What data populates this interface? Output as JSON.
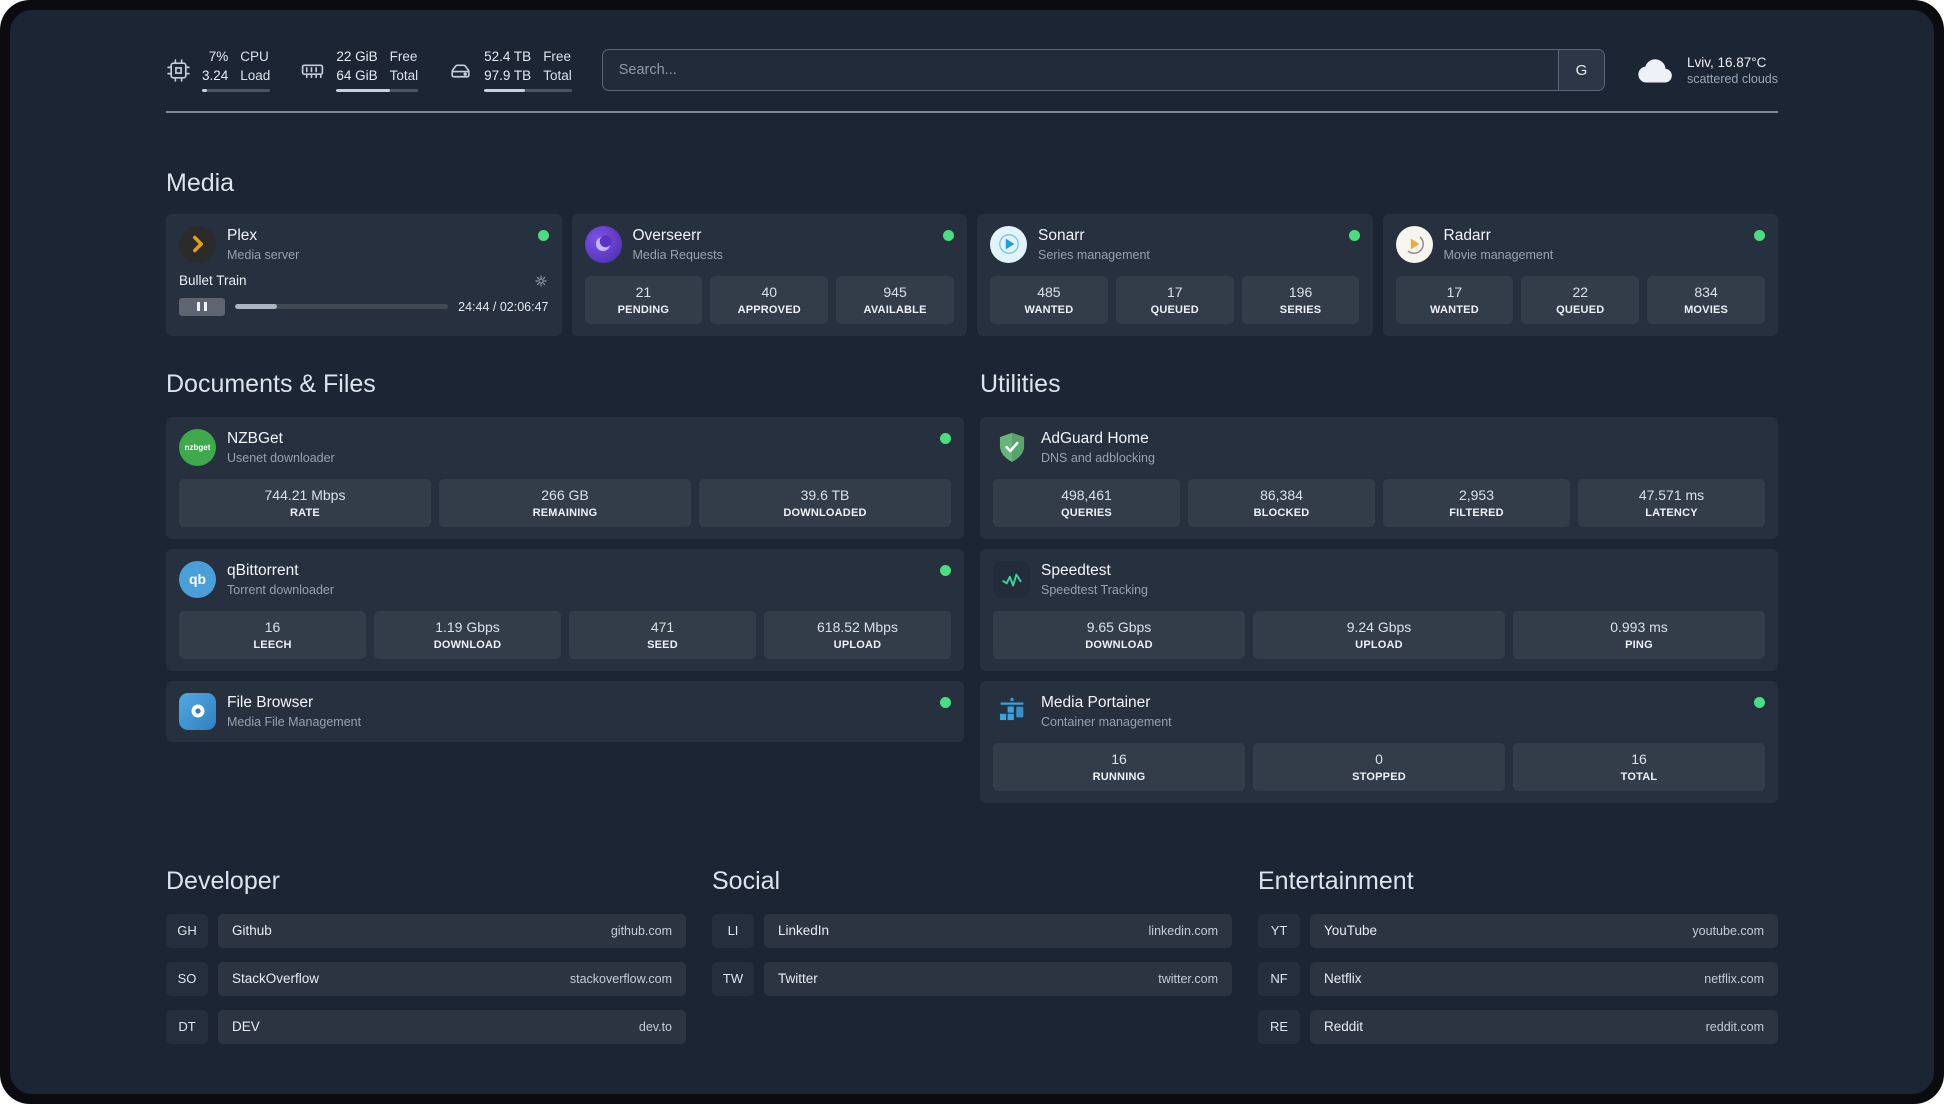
{
  "colors": {
    "background": "#1c2534",
    "status_green": "#4ade80",
    "plex_amber": "#e5a00d",
    "sonarr_blue": "#1f9fd4",
    "radarr_amber": "#f0a83c",
    "nzbget_green": "#3faa4b",
    "qbittorrent_blue": "#4a9fd8",
    "adguard_green": "#68b47a",
    "speedtest_green": "#37d399",
    "portainer_blue": "#3aa2e0"
  },
  "topbar": {
    "cpu": {
      "value_top": "7%",
      "value_bottom": "3.24",
      "label_top": "CPU",
      "label_bottom": "Load",
      "bar_percent": 7
    },
    "memory": {
      "value_top": "22 GiB",
      "value_bottom": "64 GiB",
      "label_top": "Free",
      "label_bottom": "Total",
      "bar_percent": 66
    },
    "disk": {
      "value_top": "52.4 TB",
      "value_bottom": "97.9 TB",
      "label_top": "Free",
      "label_bottom": "Total",
      "bar_percent": 47
    },
    "search": {
      "placeholder": "Search...",
      "provider_label": "G"
    },
    "weather": {
      "location_temp": "Lviv, 16.87°C",
      "condition": "scattered clouds"
    }
  },
  "media": {
    "title": "Media",
    "plex": {
      "name": "Plex",
      "subtitle": "Media server",
      "now_playing": "Bullet Train",
      "time": "24:44 / 02:06:47",
      "progress_percent": 19.5
    },
    "overseerr": {
      "name": "Overseerr",
      "subtitle": "Media Requests",
      "stats": [
        {
          "value": "21",
          "label": "PENDING"
        },
        {
          "value": "40",
          "label": "APPROVED"
        },
        {
          "value": "945",
          "label": "AVAILABLE"
        }
      ]
    },
    "sonarr": {
      "name": "Sonarr",
      "subtitle": "Series management",
      "stats": [
        {
          "value": "485",
          "label": "WANTED"
        },
        {
          "value": "17",
          "label": "QUEUED"
        },
        {
          "value": "196",
          "label": "SERIES"
        }
      ]
    },
    "radarr": {
      "name": "Radarr",
      "subtitle": "Movie management",
      "stats": [
        {
          "value": "17",
          "label": "WANTED"
        },
        {
          "value": "22",
          "label": "QUEUED"
        },
        {
          "value": "834",
          "label": "MOVIES"
        }
      ]
    }
  },
  "documents": {
    "title": "Documents & Files",
    "nzbget": {
      "name": "NZBGet",
      "subtitle": "Usenet downloader",
      "stats": [
        {
          "value": "744.21 Mbps",
          "label": "RATE"
        },
        {
          "value": "266 GB",
          "label": "REMAINING"
        },
        {
          "value": "39.6 TB",
          "label": "DOWNLOADED"
        }
      ]
    },
    "qbittorrent": {
      "name": "qBittorrent",
      "subtitle": "Torrent downloader",
      "stats": [
        {
          "value": "16",
          "label": "LEECH"
        },
        {
          "value": "1.19 Gbps",
          "label": "DOWNLOAD"
        },
        {
          "value": "471",
          "label": "SEED"
        },
        {
          "value": "618.52 Mbps",
          "label": "UPLOAD"
        }
      ]
    },
    "filebrowser": {
      "name": "File Browser",
      "subtitle": "Media File Management"
    }
  },
  "utilities": {
    "title": "Utilities",
    "adguard": {
      "name": "AdGuard Home",
      "subtitle": "DNS and adblocking",
      "stats": [
        {
          "value": "498,461",
          "label": "QUERIES"
        },
        {
          "value": "86,384",
          "label": "BLOCKED"
        },
        {
          "value": "2,953",
          "label": "FILTERED"
        },
        {
          "value": "47.571 ms",
          "label": "LATENCY"
        }
      ]
    },
    "speedtest": {
      "name": "Speedtest",
      "subtitle": "Speedtest Tracking",
      "stats": [
        {
          "value": "9.65 Gbps",
          "label": "DOWNLOAD"
        },
        {
          "value": "9.24 Gbps",
          "label": "UPLOAD"
        },
        {
          "value": "0.993 ms",
          "label": "PING"
        }
      ]
    },
    "portainer": {
      "name": "Media Portainer",
      "subtitle": "Container management",
      "stats": [
        {
          "value": "16",
          "label": "RUNNING"
        },
        {
          "value": "0",
          "label": "STOPPED"
        },
        {
          "value": "16",
          "label": "TOTAL"
        }
      ]
    }
  },
  "icons": {
    "nzbget_text": "nzbget",
    "qbittorrent_text": "qb"
  },
  "bookmarks": [
    {
      "title": "Developer",
      "items": [
        {
          "abbr": "GH",
          "name": "Github",
          "url": "github.com"
        },
        {
          "abbr": "SO",
          "name": "StackOverflow",
          "url": "stackoverflow.com"
        },
        {
          "abbr": "DT",
          "name": "DEV",
          "url": "dev.to"
        }
      ]
    },
    {
      "title": "Social",
      "items": [
        {
          "abbr": "LI",
          "name": "LinkedIn",
          "url": "linkedin.com"
        },
        {
          "abbr": "TW",
          "name": "Twitter",
          "url": "twitter.com"
        }
      ]
    },
    {
      "title": "Entertainment",
      "items": [
        {
          "abbr": "YT",
          "name": "YouTube",
          "url": "youtube.com"
        },
        {
          "abbr": "NF",
          "name": "Netflix",
          "url": "netflix.com"
        },
        {
          "abbr": "RE",
          "name": "Reddit",
          "url": "reddit.com"
        }
      ]
    }
  ]
}
